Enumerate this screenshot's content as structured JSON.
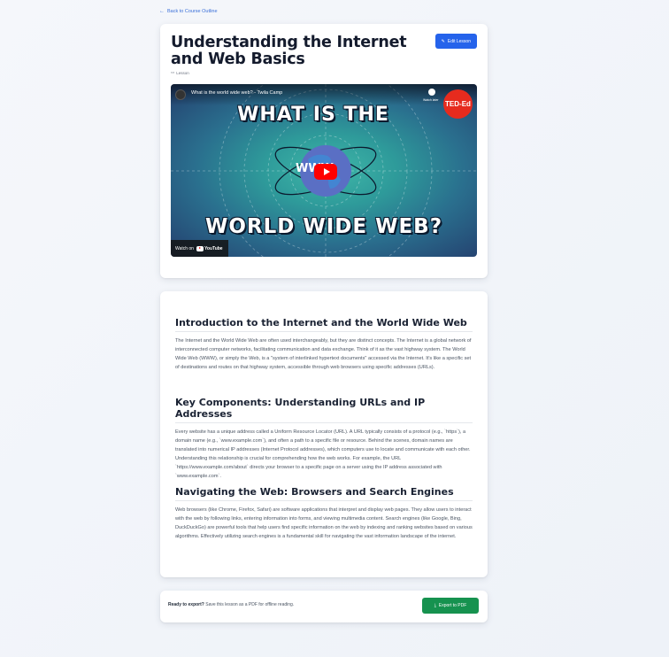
{
  "nav": {
    "back_label": "Back to Course Outline"
  },
  "lesson": {
    "title": "Understanding the Internet and Web Basics",
    "type_label": "Lesson",
    "edit_label": "Edit Lesson"
  },
  "video": {
    "title": "What is the world wide web? - Twila Camp",
    "watch_later": "Watch later",
    "headline_top": "WHAT IS THE",
    "headline_bottom": "WORLD WIDE WEB?",
    "center_text": "WWW",
    "channel_badge": "TED-Ed",
    "watch_on": "Watch on",
    "youtube": "YouTube"
  },
  "sections": [
    {
      "heading": "Introduction to the Internet and the World Wide Web",
      "body": "The Internet and the World Wide Web are often used interchangeably, but they are distinct concepts. The Internet is a global network of interconnected computer networks, facilitating communication and data exchange. Think of it as the vast highway system. The World Wide Web (WWW), or simply the Web, is a \"system of interlinked hypertext documents\" accessed via the Internet. It's like a specific set of destinations and routes on that highway system, accessible through web browsers using specific addresses (URLs)."
    },
    {
      "heading": "Key Components: Understanding URLs and IP Addresses",
      "body": "Every website has a unique address called a Uniform Resource Locator (URL). A URL typically consists of a protocol (e.g., `https`), a domain name (e.g., `www.example.com`), and often a path to a specific file or resource. Behind the scenes, domain names are translated into numerical IP addresses (Internet Protocol addresses), which computers use to locate and communicate with each other. Understanding this relationship is crucial for comprehending how the web works. For example, the URL `https://www.example.com/about` directs your browser to a specific page on a server using the IP address associated with `www.example.com`."
    },
    {
      "heading": "Navigating the Web: Browsers and Search Engines",
      "body": "Web browsers (like Chrome, Firefox, Safari) are software applications that interpret and display web pages. They allow users to interact with the web by following links, entering information into forms, and viewing multimedia content. Search engines (like Google, Bing, DuckDuckGo) are powerful tools that help users find specific information on the web by indexing and ranking websites based on various algorithms. Effectively utilizing search engines is a fundamental skill for navigating the vast information landscape of the internet."
    }
  ],
  "export": {
    "prompt_bold": "Ready to export?",
    "prompt_text": "Save this lesson as a PDF for offline reading.",
    "button_label": "Export to PDF"
  },
  "colors": {
    "accent": "#2563eb",
    "export": "#16924f",
    "youtube_red": "#ff0000"
  }
}
